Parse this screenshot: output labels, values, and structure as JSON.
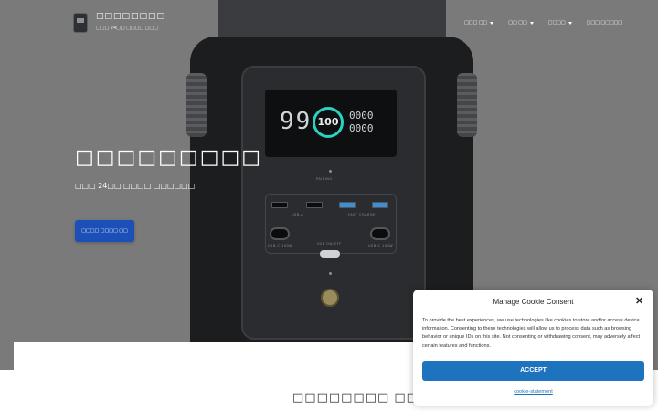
{
  "header": {
    "site_title": "□□□□□□□□",
    "site_tagline": "□□□ 24□□ □□□□ □□□",
    "nav": [
      {
        "label": "□□□ □□",
        "has_dropdown": true
      },
      {
        "label": "□□ □□",
        "has_dropdown": true
      },
      {
        "label": "□□□□",
        "has_dropdown": true
      },
      {
        "label": "□□□ □□□□□",
        "has_dropdown": false
      }
    ]
  },
  "hero": {
    "title": "□□□□□□□□□",
    "subtitle": "□□□ 24□□ □□□□ □□□□□□",
    "cta_label": "□□□□ □□□□ □□"
  },
  "product_display": {
    "battery_percent": "100",
    "level_digits": "99",
    "readout_left": "0000",
    "readout_right": "0000",
    "port_labels": {
      "usb_a": "USB-A",
      "fast_charge": "FAST CHARGE",
      "usbc_left": "USB-C 100W",
      "usbc_right": "USB-C 100W",
      "dc": "USB ON/OFF",
      "pairing": "PAIRING"
    }
  },
  "section": {
    "title": "□□□□□□□□ □□"
  },
  "cookie_consent": {
    "title": "Manage Cookie Consent",
    "body": "To provide the best experiences, we use technologies like cookies to store and/or access device information. Consenting to these technologies will allow us to process data such as browsing behavior or unique IDs on this site. Not consenting or withdrawing consent, may adversely affect certain features and functions.",
    "accept_label": "ACCEPT",
    "link_label": "cookie-statement",
    "accent_color": "#1e73be"
  },
  "colors": {
    "hero_bg": "#7a7a7a",
    "cta": "#1c4fb8",
    "lcd_ring": "#2bd1c2"
  }
}
